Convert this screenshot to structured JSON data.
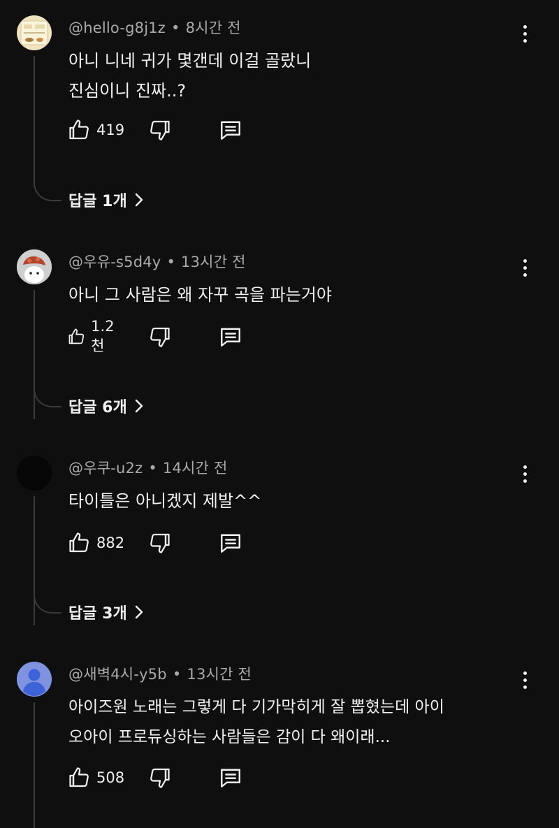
{
  "comments": [
    {
      "author": "@hello-g8j1z",
      "time": "8시간 전",
      "lines": [
        "아니 니네 귀가 몇갠데 이걸 골랐니",
        "진심이니 진짜..?"
      ],
      "likes": "419",
      "replies": "답글 1개"
    },
    {
      "author": "@우유-s5d4y",
      "time": "13시간 전",
      "lines": [
        "아니 그 사람은 왜 자꾸 곡을 파는거야"
      ],
      "likes": "1.2천",
      "replies": "답글 6개"
    },
    {
      "author": "@우쿠-u2z",
      "time": "14시간 전",
      "lines": [
        "타이틀은 아니겠지 제발^^"
      ],
      "likes": "882",
      "replies": "답글 3개"
    },
    {
      "author": "@새벽4시-y5b",
      "time": "13시간 전",
      "lines": [
        "아이즈원 노래는 그렇게 다 기가막히게 잘 뽑혔는데 아이",
        "오아이 프로듀싱하는 사람들은 감이 다 왜이래..."
      ],
      "likes": "508"
    }
  ],
  "separator": "•",
  "icons": {
    "like": "thumb-up-icon",
    "dislike": "thumb-down-icon",
    "reply": "comment-icon",
    "more": "more-vert-icon",
    "chevron": "chevron-right-icon"
  },
  "colors": {
    "background": "#0f0f0f",
    "text": "#f1f1f1",
    "meta": "#aaaaaa",
    "thread": "#3a3a3a",
    "default_avatar": "#7f93e0"
  }
}
